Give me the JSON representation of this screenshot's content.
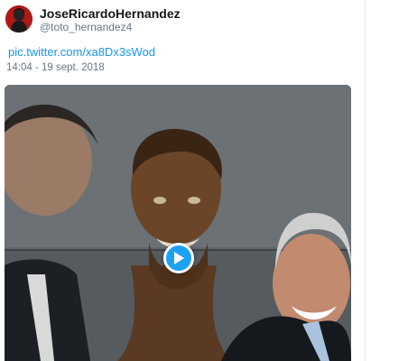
{
  "tweet": {
    "display_name": "JoseRicardoHernandez",
    "handle": "@toto_hernandez4",
    "link_text": "pic.twitter.com/xa8Dx3sWod",
    "timestamp": "14:04 - 19 sept. 2018"
  },
  "icons": {
    "avatar": "profile-avatar",
    "play": "play-icon"
  },
  "colors": {
    "name": "#14171a",
    "secondary_text": "#657786",
    "link": "#1b95e0",
    "play_button": "#1da1f2"
  }
}
